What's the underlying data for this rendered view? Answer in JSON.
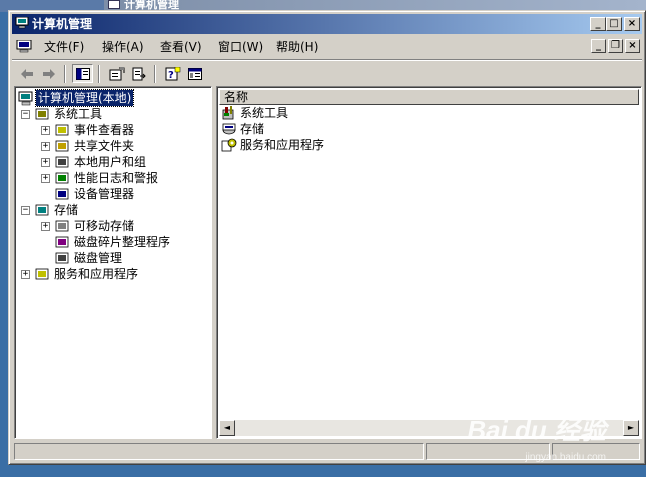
{
  "background_window": {
    "title": "计算机管理"
  },
  "window": {
    "title": "计算机管理",
    "buttons": {
      "minimize": "_",
      "maximize": "□",
      "close": "×"
    }
  },
  "menu": {
    "items": [
      "文件(F)",
      "操作(A)",
      "查看(V)",
      "窗口(W)",
      "帮助(H)"
    ],
    "child_buttons": {
      "minimize": "_",
      "restore": "❐",
      "close": "×"
    }
  },
  "toolbar": {
    "icons": [
      "back-icon",
      "forward-icon",
      "show-hide-tree-icon",
      "properties-icon",
      "export-list-icon",
      "help-icon",
      "description-bar-icon"
    ]
  },
  "tree": {
    "root": "计算机管理(本地)",
    "items": [
      {
        "label": "系统工具",
        "level": 1,
        "expander": "−"
      },
      {
        "label": "事件查看器",
        "level": 2,
        "expander": "+"
      },
      {
        "label": "共享文件夹",
        "level": 2,
        "expander": "+"
      },
      {
        "label": "本地用户和组",
        "level": 2,
        "expander": "+"
      },
      {
        "label": "性能日志和警报",
        "level": 2,
        "expander": "+"
      },
      {
        "label": "设备管理器",
        "level": 2,
        "expander": ""
      },
      {
        "label": "存储",
        "level": 1,
        "expander": "−"
      },
      {
        "label": "可移动存储",
        "level": 2,
        "expander": "+"
      },
      {
        "label": "磁盘碎片整理程序",
        "level": 2,
        "expander": ""
      },
      {
        "label": "磁盘管理",
        "level": 2,
        "expander": ""
      },
      {
        "label": "服务和应用程序",
        "level": 1,
        "expander": "+"
      }
    ]
  },
  "list": {
    "column_header": "名称",
    "items": [
      "系统工具",
      "存储",
      "服务和应用程序"
    ],
    "scroll_left": "◄",
    "scroll_right": "►"
  },
  "watermark": {
    "text": "Bai du 经验",
    "sub": "jingyan.baidu.com"
  },
  "colors": {
    "desktop": "#3a6ea5",
    "titlebar_start": "#0a246a",
    "titlebar_end": "#a6caf0",
    "face": "#d4d0c8",
    "selection": "#0a246a"
  }
}
